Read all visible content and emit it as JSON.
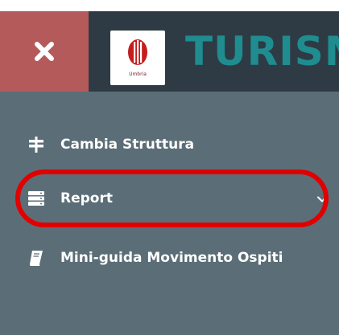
{
  "header": {
    "app_title": "TURISMA",
    "logo_caption": "Umbria",
    "close_icon": "close-icon",
    "close_color": "#b55a5a",
    "bar_color": "#2e3b44",
    "title_color": "#1f8c8f"
  },
  "sidebar": {
    "background": "#5b6e77",
    "items": [
      {
        "label": "Cambia Struttura",
        "icon": "signpost-icon"
      },
      {
        "label": "Report",
        "icon": "server-icon",
        "has_submenu": true
      },
      {
        "label": "Mini-guida Movimento Ospiti",
        "icon": "book-icon"
      }
    ]
  },
  "annotation": {
    "type": "highlight-ellipse",
    "target": "Report",
    "color": "#e00000"
  }
}
